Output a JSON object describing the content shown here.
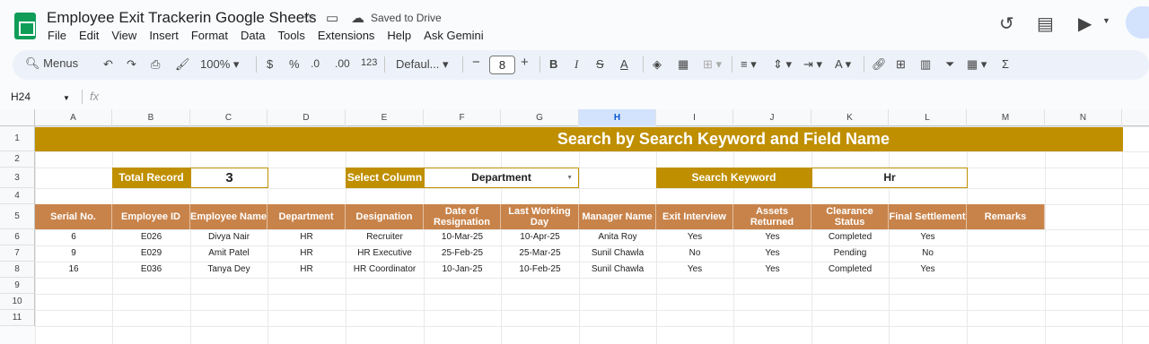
{
  "app": {
    "title": "Employee Exit Trackerin Google Sheets",
    "saved_status": "Saved to Drive",
    "menus": [
      "File",
      "Edit",
      "View",
      "Insert",
      "Format",
      "Data",
      "Tools",
      "Extensions",
      "Help",
      "Ask Gemini"
    ]
  },
  "toolbar": {
    "search_label": "Menus",
    "zoom": "100%",
    "currency": "$",
    "percent": "%",
    "decrease_decimal": ".0",
    "increase_decimal": ".00",
    "number_format": "123",
    "font": "Defaul...",
    "font_size": "8"
  },
  "formula_bar": {
    "name_box": "H24",
    "fx": "fx"
  },
  "columns": [
    "A",
    "B",
    "C",
    "D",
    "E",
    "F",
    "G",
    "H",
    "I",
    "J",
    "K",
    "L",
    "M",
    "N"
  ],
  "rows": [
    "1",
    "2",
    "3",
    "4",
    "5",
    "6",
    "7",
    "8",
    "9",
    "10",
    "11"
  ],
  "sheet": {
    "banner": "Search by Search Keyword and Field Name",
    "total_record_label": "Total Record",
    "total_record_value": "3",
    "select_column_label": "Select Column",
    "select_column_value": "Department",
    "search_keyword_label": "Search Keyword",
    "search_keyword_value": "Hr",
    "headers": [
      "Serial No.",
      "Employee ID",
      "Employee Name",
      "Department",
      "Designation",
      "Date of Resignation",
      "Last Working Day",
      "Manager Name",
      "Exit Interview",
      "Assets Returned",
      "Clearance Status",
      "Final Settlement",
      "Remarks"
    ],
    "data_rows": [
      [
        "6",
        "E026",
        "Divya Nair",
        "HR",
        "Recruiter",
        "10-Mar-25",
        "10-Apr-25",
        "Anita Roy",
        "Yes",
        "Yes",
        "Completed",
        "Yes",
        ""
      ],
      [
        "9",
        "E029",
        "Amit Patel",
        "HR",
        "HR Executive",
        "25-Feb-25",
        "25-Mar-25",
        "Sunil Chawla",
        "No",
        "Yes",
        "Pending",
        "No",
        ""
      ],
      [
        "16",
        "E036",
        "Tanya Dey",
        "HR",
        "HR Coordinator",
        "10-Jan-25",
        "10-Feb-25",
        "Sunil Chawla",
        "Yes",
        "Yes",
        "Completed",
        "Yes",
        ""
      ]
    ]
  },
  "colors": {
    "accent": "#bf8f00",
    "header": "#c8834a",
    "selection": "#d3e3fd"
  }
}
